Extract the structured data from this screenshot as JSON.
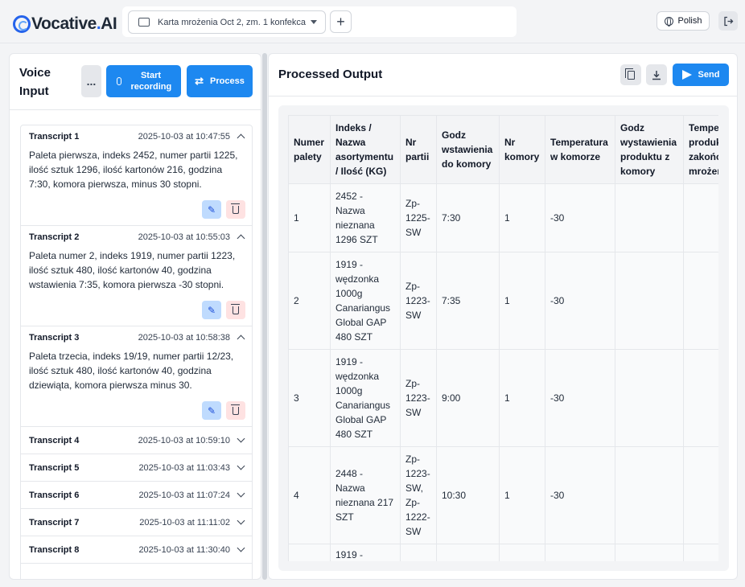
{
  "app": {
    "logo_text": "Vocative.AI",
    "document_select": "Karta mrożenia Oct 2, zm. 1 konfekca",
    "add_label": "+",
    "language": "Polish"
  },
  "left": {
    "title": "Voice Input",
    "more_label": "...",
    "start_label": "Start recording",
    "process_label": "Process",
    "transcripts": [
      {
        "name": "Transcript 1",
        "time": "2025-10-03 at 10:47:55",
        "text": "Paleta pierwsza, indeks 2452, numer partii 1225, ilość sztuk 1296, ilość kartonów 216, godzina 7:30, komora pierwsza, minus 30 stopni."
      },
      {
        "name": "Transcript 2",
        "time": "2025-10-03 at 10:55:03",
        "text": "Paleta numer 2, indeks 1919, numer partii 1223, ilość sztuk 480, ilość kartonów 40, godzina wstawienia 7:35, komora pierwsza -30 stopni."
      },
      {
        "name": "Transcript 3",
        "time": "2025-10-03 at 10:58:38",
        "text": "Paleta trzecia, indeks 19/19, numer partii 12/23, ilość sztuk 480, ilość kartonów 40, godzina dziewiąta, komora pierwsza minus 30."
      },
      {
        "name": "Transcript 4",
        "time": "2025-10-03 at 10:59:10"
      },
      {
        "name": "Transcript 5",
        "time": "2025-10-03 at 11:03:43"
      },
      {
        "name": "Transcript 6",
        "time": "2025-10-03 at 11:07:24"
      },
      {
        "name": "Transcript 7",
        "time": "2025-10-03 at 11:11:02"
      },
      {
        "name": "Transcript 8",
        "time": "2025-10-03 at 11:30:40"
      }
    ]
  },
  "right": {
    "title": "Processed Output",
    "send_label": "Send",
    "headers": [
      "Numer palety",
      "Indeks / Nazwa asortymentu / Ilość (KG)",
      "Nr partii",
      "Godz wstawienia do komory",
      "Nr komory",
      "Temperatura w komorze",
      "Godz wystawienia produktu z komory",
      "Temperatura produktu zakończenia mrożenia"
    ],
    "rows": [
      [
        "1",
        "2452 - Nazwa nieznana 1296 SZT",
        "Zp-1225-SW",
        "7:30",
        "1",
        "-30",
        "",
        ""
      ],
      [
        "2",
        "1919 - wędzonka 1000g Canariangus Global GAP 480 SZT",
        "Zp-1223-SW",
        "7:35",
        "1",
        "-30",
        "",
        ""
      ],
      [
        "3",
        "1919 - wędzonka 1000g Canariangus Global GAP 480 SZT",
        "Zp-1223-SW",
        "9:00",
        "1",
        "-30",
        "",
        ""
      ],
      [
        "4",
        "2448 - Nazwa nieznana 217 SZT",
        "Zp-1223-SW, Zp-1222-SW",
        "10:30",
        "1",
        "-30",
        "",
        ""
      ],
      [
        "",
        "1919 -",
        "",
        "",
        "",
        "",
        "",
        ""
      ]
    ]
  }
}
